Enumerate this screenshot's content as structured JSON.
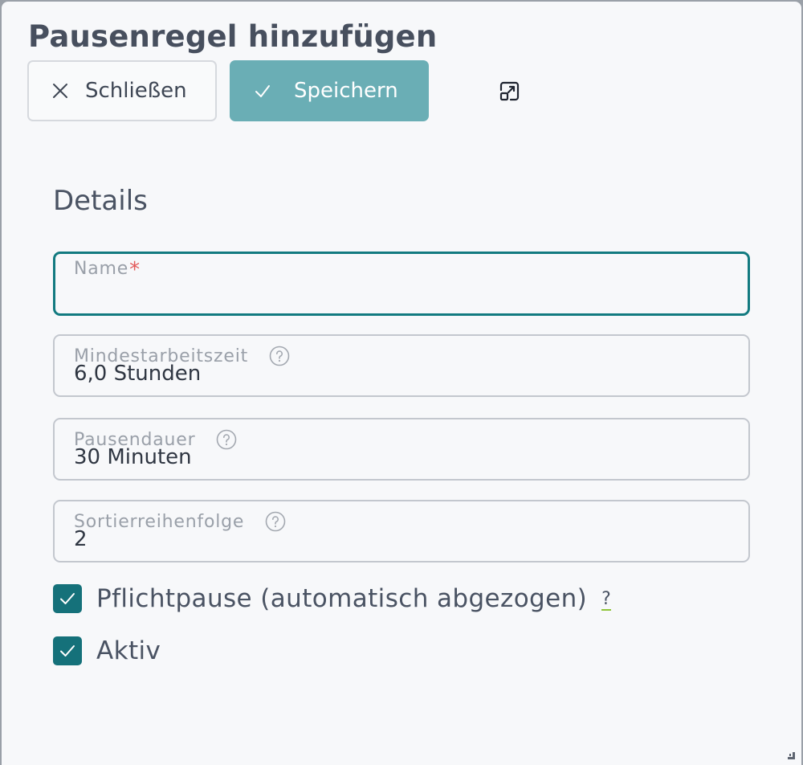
{
  "dialog": {
    "title": "Pausenregel hinzufügen",
    "close_label": "Schließen",
    "save_label": "Speichern"
  },
  "details": {
    "section_title": "Details",
    "name": {
      "label": "Name",
      "required_mark": "*",
      "value": ""
    },
    "mindestarbeitszeit": {
      "label": "Mindestarbeitszeit",
      "value": "6,0 Stunden"
    },
    "pausendauer": {
      "label": "Pausendauer",
      "value": "30 Minuten"
    },
    "sortierreihenfolge": {
      "label": "Sortierreihenfolge",
      "value": "2"
    },
    "pflichtpause": {
      "label": "Pflichtpause (automatisch abgezogen)",
      "help": "?",
      "checked": true
    },
    "aktiv": {
      "label": "Aktiv",
      "checked": true
    }
  },
  "colors": {
    "primary": "#15717a",
    "save_button": "#6aaeb5",
    "focus_border": "#127a80",
    "required": "#e35b5b"
  },
  "icons": {
    "close": "close-icon",
    "save": "check-icon",
    "expand": "expand-icon",
    "help": "help-circle-icon",
    "resize": "resize-grip-icon"
  }
}
